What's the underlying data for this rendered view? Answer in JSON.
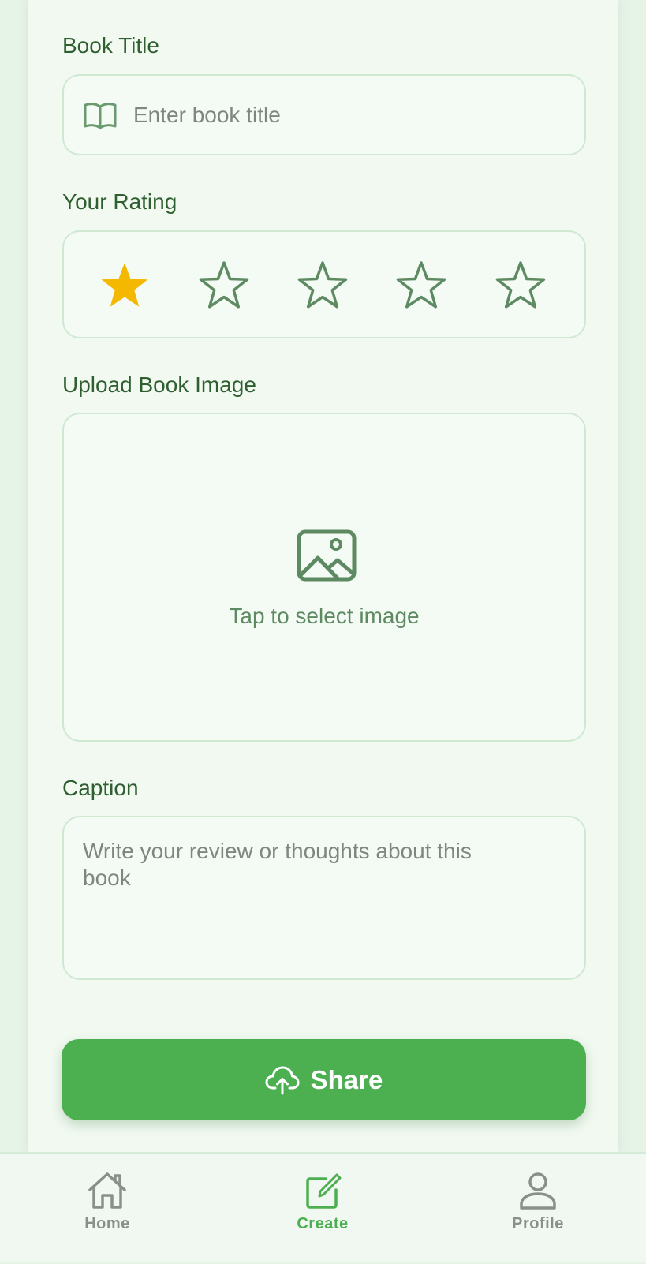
{
  "form": {
    "book_title_label": "Book Title",
    "book_title_placeholder": "Enter book title",
    "book_title_value": "",
    "rating_label": "Your Rating",
    "rating": {
      "value": 1,
      "max": 5
    },
    "upload_label": "Upload Book Image",
    "upload_prompt": "Tap to select image",
    "caption_label": "Caption",
    "caption_placeholder": "Write your review or thoughts about this book",
    "caption_value": "",
    "share_label": "Share"
  },
  "nav": {
    "items": [
      {
        "label": "Home",
        "icon": "home-icon",
        "active": false
      },
      {
        "label": "Create",
        "icon": "create-icon",
        "active": true
      },
      {
        "label": "Profile",
        "icon": "profile-icon",
        "active": false
      }
    ]
  },
  "colors": {
    "accent": "#4caf50",
    "label_text": "#2f5f30",
    "icon_green": "#5e8a62",
    "star_filled": "#f5b800",
    "nav_inactive": "#8a8f8a",
    "background": "#e6f3e7"
  }
}
